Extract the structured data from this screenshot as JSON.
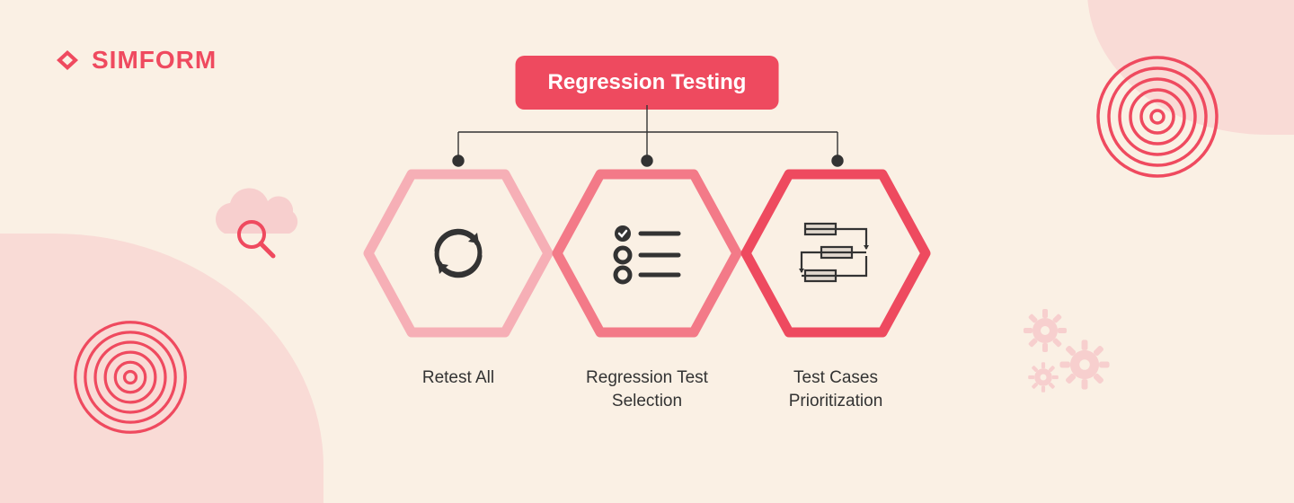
{
  "brand": "SIMFORM",
  "title": "Regression Testing",
  "hexes": [
    {
      "label": "Retest All",
      "icon": "refresh-icon",
      "stroke": "#f6afb6"
    },
    {
      "label": "Regression Test Selection",
      "icon": "checklist-icon",
      "stroke": "#f37a88"
    },
    {
      "label": "Test Cases Prioritization",
      "icon": "flowchart-icon",
      "stroke": "#ee4a5f"
    }
  ],
  "colors": {
    "accent": "#ee4a5f",
    "bg": "#faf0e4",
    "blob": "#f9dbd6",
    "dark": "#333333"
  },
  "chart_data": {
    "type": "tree",
    "root": "Regression Testing",
    "children": [
      "Retest All",
      "Regression Test Selection",
      "Test Cases Prioritization"
    ]
  }
}
